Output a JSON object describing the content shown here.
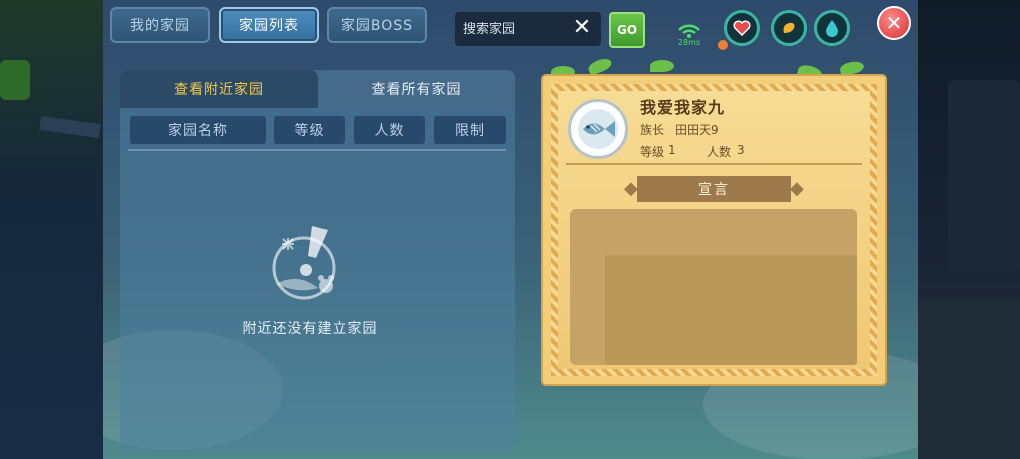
{
  "top_tabs": [
    {
      "label": "我的家园",
      "active": false
    },
    {
      "label": "家园列表",
      "active": true
    },
    {
      "label": "家园BOSS",
      "active": false
    }
  ],
  "search": {
    "placeholder": "搜索家园",
    "clear_icon": "✕"
  },
  "go_button": {
    "label": "GO"
  },
  "network": {
    "ping": "28ms"
  },
  "status_icons": [
    "heart-icon",
    "hunger-icon",
    "water-drop-icon"
  ],
  "close_icon": "✕",
  "list_panel": {
    "tabs": [
      {
        "label": "查看附近家园",
        "active": true
      },
      {
        "label": "查看所有家园",
        "active": false
      }
    ],
    "columns": [
      "家园名称",
      "等级",
      "人数",
      "限制"
    ],
    "empty_text": "附近还没有建立家园"
  },
  "home_card": {
    "name": "我爱我家九",
    "leader_label": "族长",
    "leader": "田田天9",
    "level_label": "等级",
    "level": "1",
    "count_label": "人数",
    "count": "3",
    "manifesto_title": "宣言",
    "manifesto_text": ""
  }
}
